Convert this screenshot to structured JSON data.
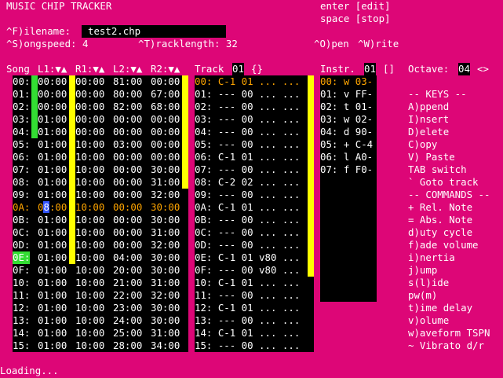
{
  "app": {
    "title": "MUSIC CHIP TRACKER",
    "status": "Loading..."
  },
  "header": {
    "enter_label": "enter [edit]",
    "space_label": "space [stop]",
    "filename_label": "^F)ilename:",
    "filename_value": "test2.chp",
    "songspeed_label": "^S)ongspeed: 4",
    "tracklength_label": "^T)racklength: 32",
    "open_label": "^O)pen",
    "write_label": "^W)rite"
  },
  "song": {
    "head_song": "Song",
    "head_l1": "L1:▼▲",
    "head_r1": "R1:▼▲",
    "head_l2": "L2:▼▲",
    "head_r2": "R2:▼▲",
    "rows": [
      [
        "00:",
        "00:00",
        "00:00",
        "81:00",
        "00:00"
      ],
      [
        "01:",
        "00:00",
        "00:00",
        "80:00",
        "67:00"
      ],
      [
        "02:",
        "00:00",
        "00:00",
        "82:00",
        "68:00"
      ],
      [
        "03:",
        "01:00",
        "00:00",
        "00:00",
        "00:00"
      ],
      [
        "04:",
        "01:00",
        "00:00",
        "00:00",
        "00:00"
      ],
      [
        "05:",
        "01:00",
        "10:00",
        "03:00",
        "00:00"
      ],
      [
        "06:",
        "01:00",
        "10:00",
        "00:00",
        "00:00"
      ],
      [
        "07:",
        "01:00",
        "10:00",
        "00:00",
        "30:00"
      ],
      [
        "08:",
        "01:00",
        "10:00",
        "00:00",
        "31:00"
      ],
      [
        "09:",
        "01:00",
        "10:00",
        "00:00",
        "32:00"
      ],
      [
        "0A:",
        "08:00",
        "10:00",
        "00:00",
        "30:00"
      ],
      [
        "0B:",
        "01:00",
        "10:00",
        "00:00",
        "30:00"
      ],
      [
        "0C:",
        "01:00",
        "10:00",
        "00:00",
        "31:00"
      ],
      [
        "0D:",
        "01:00",
        "10:00",
        "00:00",
        "32:00"
      ],
      [
        "0E:",
        "01:00",
        "10:00",
        "04:00",
        "30:00"
      ],
      [
        "0F:",
        "01:00",
        "10:00",
        "20:00",
        "30:00"
      ],
      [
        "10:",
        "01:00",
        "10:00",
        "21:00",
        "31:00"
      ],
      [
        "11:",
        "01:00",
        "10:00",
        "22:00",
        "32:00"
      ],
      [
        "12:",
        "01:00",
        "10:00",
        "23:00",
        "30:00"
      ],
      [
        "13:",
        "01:00",
        "10:00",
        "24:00",
        "30:00"
      ],
      [
        "14:",
        "01:00",
        "10:00",
        "25:00",
        "31:00"
      ],
      [
        "15:",
        "01:00",
        "10:00",
        "28:00",
        "34:00"
      ]
    ]
  },
  "track": {
    "label": "Track",
    "number": "01",
    "braces": "{}",
    "rows": [
      "00: C-1 01 ... ...",
      "01: --- 00 ... ...",
      "02: --- 00 ... ...",
      "03: --- 00 ... ...",
      "04: --- 00 ... ...",
      "05: --- 00 ... ...",
      "06: C-1 01 ... ...",
      "07: --- 00 ... ...",
      "08: C-2 02 ... ...",
      "09: --- 00 ... ...",
      "0A: C-1 01 ... ...",
      "0B: --- 00 ... ...",
      "0C: --- 00 ... ...",
      "0D: --- 00 ... ...",
      "0E: C-1 01 v80 ...",
      "0F: --- 00 v80 ...",
      "10: C-1 01 ... ...",
      "11: --- 00 ... ...",
      "12: C-1 01 ... ...",
      "13: --- 00 ... ...",
      "14: C-1 01 ... ...",
      "15: --- 00 ... ..."
    ]
  },
  "instr": {
    "label": "Instr.",
    "number": "01",
    "brackets": "[]",
    "rows": [
      "00: w 03-",
      "01: v FF-",
      "02: t 01-",
      "03: w 02-",
      "04: d 90-",
      "05: + C-4",
      "06: l A0-",
      "07: f F0-"
    ]
  },
  "octave": {
    "label": "Octave:",
    "value": "04",
    "arrows": "<>"
  },
  "help": [
    "-- KEYS --",
    "A)ppend",
    "I)nsert",
    "D)elete",
    "C)opy",
    "V) Paste",
    "TAB switch",
    "` Goto track",
    "-- COMMANDS --",
    "+ Rel. Note",
    "= Abs. Note",
    "d)uty cycle",
    "f)ade volume",
    "i)nertia",
    "j)ump",
    "s(l)ide",
    "pw(m)",
    "t)ime delay",
    "v)olume",
    "w)aveform TSPN",
    "~ Vibrato d/r"
  ],
  "colors": {
    "background": "#dd0677",
    "panel": "#000000",
    "marker_yellow": "#ffff00",
    "marker_green": "#33dd33",
    "cursor_orange": "#ffa500",
    "cursor_blue": "#3355ff"
  }
}
